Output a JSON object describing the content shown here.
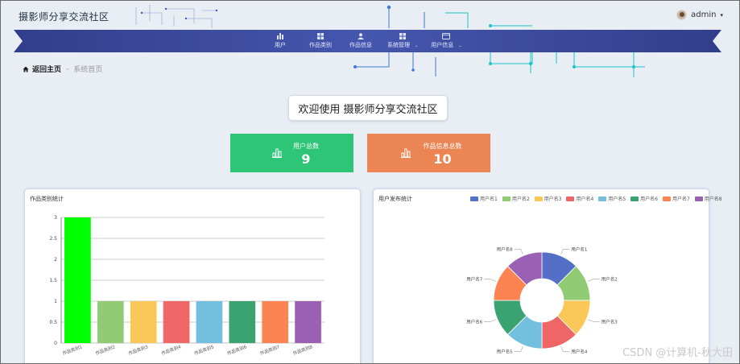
{
  "header": {
    "app_title": "摄影师分享交流社区",
    "user_name": "admin",
    "user_caret": "▾"
  },
  "nav": {
    "items": [
      {
        "label": "用户",
        "icon": "bar-chart-icon",
        "dropdown": false
      },
      {
        "label": "作品类别",
        "icon": "grid-icon",
        "dropdown": false
      },
      {
        "label": "作品信息",
        "icon": "person-icon",
        "dropdown": false
      },
      {
        "label": "系统管理",
        "icon": "grid-icon",
        "dropdown": true
      },
      {
        "label": "用户信息",
        "icon": "monitor-icon",
        "dropdown": true
      }
    ],
    "ribbon_color": "#3d4ba1"
  },
  "breadcrumb": {
    "home": "返回主页",
    "separator": "-",
    "current": "系统首页"
  },
  "welcome": "欢迎使用 摄影师分享交流社区",
  "stats": [
    {
      "label": "用户总数",
      "value": "9",
      "color": "#2ec576"
    },
    {
      "label": "作品信息总数",
      "value": "10",
      "color": "#eb8554"
    }
  ],
  "bar_panel": {
    "title": "作品类别统计"
  },
  "pie_panel": {
    "title": "用户发布统计"
  },
  "chart_data": [
    {
      "type": "bar",
      "title": "作品类别统计",
      "categories": [
        "作品类别1",
        "作品类别2",
        "作品类别3",
        "作品类别4",
        "作品类别5",
        "作品类别6",
        "作品类别7",
        "作品类别8"
      ],
      "values": [
        3,
        1,
        1,
        1,
        1,
        1,
        1,
        1
      ],
      "colors": [
        "#00ff00",
        "#91cc75",
        "#fac858",
        "#ee6666",
        "#73c0de",
        "#3ba272",
        "#fc8452",
        "#9a60b4"
      ],
      "ylim": [
        0,
        3
      ],
      "yticks": [
        0,
        0.5,
        1,
        1.5,
        2,
        2.5,
        3
      ],
      "grid": true
    },
    {
      "type": "pie",
      "title": "用户发布统计",
      "donut": true,
      "legend_position": "top",
      "labels": [
        "用户名1",
        "用户名2",
        "用户名3",
        "用户名4",
        "用户名5",
        "用户名6",
        "用户名7",
        "用户名8"
      ],
      "values": [
        1,
        1,
        1,
        1,
        1,
        1,
        1,
        1
      ],
      "colors": [
        "#5470c6",
        "#91cc75",
        "#fac858",
        "#ee6666",
        "#73c0de",
        "#3ba272",
        "#fc8452",
        "#9a60b4"
      ]
    }
  ],
  "watermark": "CSDN @计算机-秋大田"
}
